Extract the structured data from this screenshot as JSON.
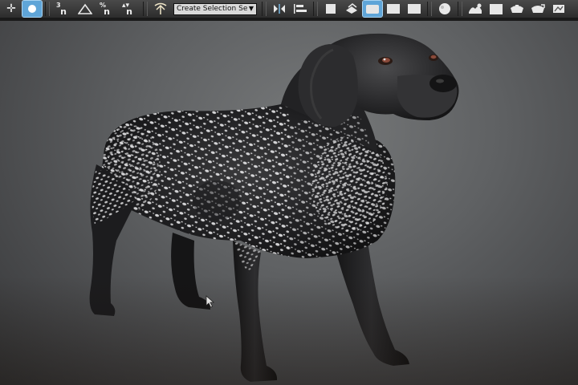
{
  "toolbar": {
    "selection_set_label": "Create Selection Se",
    "snap_toggles": [
      {
        "sup": "3",
        "base": "n"
      },
      {
        "sup": "%",
        "base": "n"
      },
      {
        "sup": "",
        "base": "n"
      }
    ],
    "icons": [
      "select-move-icon",
      "select-rotate-icon",
      "snap-3d-icon",
      "angle-snap-icon",
      "percent-snap-icon",
      "spinner-snap-icon",
      "edit-named-selection-icon",
      "mirror-icon",
      "align-icon",
      "toggle-scene-explorer-icon",
      "layer-explorer-icon",
      "toggle-ribbon-icon",
      "curve-editor-icon",
      "schematic-view-icon",
      "material-editor-icon",
      "render-setup-icon",
      "rendered-frame-window-icon",
      "render-production-icon",
      "render-iterative-icon"
    ]
  },
  "viewport": {
    "object": "dog-model"
  }
}
